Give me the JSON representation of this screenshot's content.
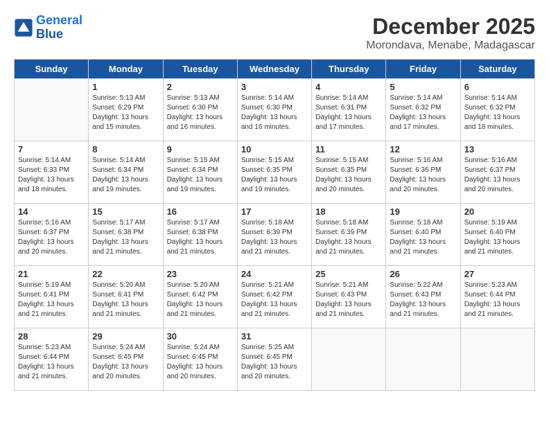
{
  "header": {
    "logo_line1": "General",
    "logo_line2": "Blue",
    "title": "December 2025",
    "subtitle": "Morondava, Menabe, Madagascar"
  },
  "days": [
    "Sunday",
    "Monday",
    "Tuesday",
    "Wednesday",
    "Thursday",
    "Friday",
    "Saturday"
  ],
  "weeks": [
    [
      {
        "date": "",
        "info": ""
      },
      {
        "date": "1",
        "info": "Sunrise: 5:13 AM\nSunset: 6:29 PM\nDaylight: 13 hours\nand 15 minutes."
      },
      {
        "date": "2",
        "info": "Sunrise: 5:13 AM\nSunset: 6:30 PM\nDaylight: 13 hours\nand 16 minutes."
      },
      {
        "date": "3",
        "info": "Sunrise: 5:14 AM\nSunset: 6:30 PM\nDaylight: 13 hours\nand 16 minutes."
      },
      {
        "date": "4",
        "info": "Sunrise: 5:14 AM\nSunset: 6:31 PM\nDaylight: 13 hours\nand 17 minutes."
      },
      {
        "date": "5",
        "info": "Sunrise: 5:14 AM\nSunset: 6:32 PM\nDaylight: 13 hours\nand 17 minutes."
      },
      {
        "date": "6",
        "info": "Sunrise: 5:14 AM\nSunset: 6:32 PM\nDaylight: 13 hours\nand 18 minutes."
      }
    ],
    [
      {
        "date": "7",
        "info": "Sunrise: 5:14 AM\nSunset: 6:33 PM\nDaylight: 13 hours\nand 18 minutes."
      },
      {
        "date": "8",
        "info": "Sunrise: 5:14 AM\nSunset: 6:34 PM\nDaylight: 13 hours\nand 19 minutes."
      },
      {
        "date": "9",
        "info": "Sunrise: 5:15 AM\nSunset: 6:34 PM\nDaylight: 13 hours\nand 19 minutes."
      },
      {
        "date": "10",
        "info": "Sunrise: 5:15 AM\nSunset: 6:35 PM\nDaylight: 13 hours\nand 19 minutes."
      },
      {
        "date": "11",
        "info": "Sunrise: 5:15 AM\nSunset: 6:35 PM\nDaylight: 13 hours\nand 20 minutes."
      },
      {
        "date": "12",
        "info": "Sunrise: 5:16 AM\nSunset: 6:36 PM\nDaylight: 13 hours\nand 20 minutes."
      },
      {
        "date": "13",
        "info": "Sunrise: 5:16 AM\nSunset: 6:37 PM\nDaylight: 13 hours\nand 20 minutes."
      }
    ],
    [
      {
        "date": "14",
        "info": "Sunrise: 5:16 AM\nSunset: 6:37 PM\nDaylight: 13 hours\nand 20 minutes."
      },
      {
        "date": "15",
        "info": "Sunrise: 5:17 AM\nSunset: 6:38 PM\nDaylight: 13 hours\nand 21 minutes."
      },
      {
        "date": "16",
        "info": "Sunrise: 5:17 AM\nSunset: 6:38 PM\nDaylight: 13 hours\nand 21 minutes."
      },
      {
        "date": "17",
        "info": "Sunrise: 5:18 AM\nSunset: 6:39 PM\nDaylight: 13 hours\nand 21 minutes."
      },
      {
        "date": "18",
        "info": "Sunrise: 5:18 AM\nSunset: 6:39 PM\nDaylight: 13 hours\nand 21 minutes."
      },
      {
        "date": "19",
        "info": "Sunrise: 5:18 AM\nSunset: 6:40 PM\nDaylight: 13 hours\nand 21 minutes."
      },
      {
        "date": "20",
        "info": "Sunrise: 5:19 AM\nSunset: 6:40 PM\nDaylight: 13 hours\nand 21 minutes."
      }
    ],
    [
      {
        "date": "21",
        "info": "Sunrise: 5:19 AM\nSunset: 6:41 PM\nDaylight: 13 hours\nand 21 minutes."
      },
      {
        "date": "22",
        "info": "Sunrise: 5:20 AM\nSunset: 6:41 PM\nDaylight: 13 hours\nand 21 minutes."
      },
      {
        "date": "23",
        "info": "Sunrise: 5:20 AM\nSunset: 6:42 PM\nDaylight: 13 hours\nand 21 minutes."
      },
      {
        "date": "24",
        "info": "Sunrise: 5:21 AM\nSunset: 6:42 PM\nDaylight: 13 hours\nand 21 minutes."
      },
      {
        "date": "25",
        "info": "Sunrise: 5:21 AM\nSunset: 6:43 PM\nDaylight: 13 hours\nand 21 minutes."
      },
      {
        "date": "26",
        "info": "Sunrise: 5:22 AM\nSunset: 6:43 PM\nDaylight: 13 hours\nand 21 minutes."
      },
      {
        "date": "27",
        "info": "Sunrise: 5:23 AM\nSunset: 6:44 PM\nDaylight: 13 hours\nand 21 minutes."
      }
    ],
    [
      {
        "date": "28",
        "info": "Sunrise: 5:23 AM\nSunset: 6:44 PM\nDaylight: 13 hours\nand 21 minutes."
      },
      {
        "date": "29",
        "info": "Sunrise: 5:24 AM\nSunset: 6:45 PM\nDaylight: 13 hours\nand 20 minutes."
      },
      {
        "date": "30",
        "info": "Sunrise: 5:24 AM\nSunset: 6:45 PM\nDaylight: 13 hours\nand 20 minutes."
      },
      {
        "date": "31",
        "info": "Sunrise: 5:25 AM\nSunset: 6:45 PM\nDaylight: 13 hours\nand 20 minutes."
      },
      {
        "date": "",
        "info": ""
      },
      {
        "date": "",
        "info": ""
      },
      {
        "date": "",
        "info": ""
      }
    ]
  ]
}
